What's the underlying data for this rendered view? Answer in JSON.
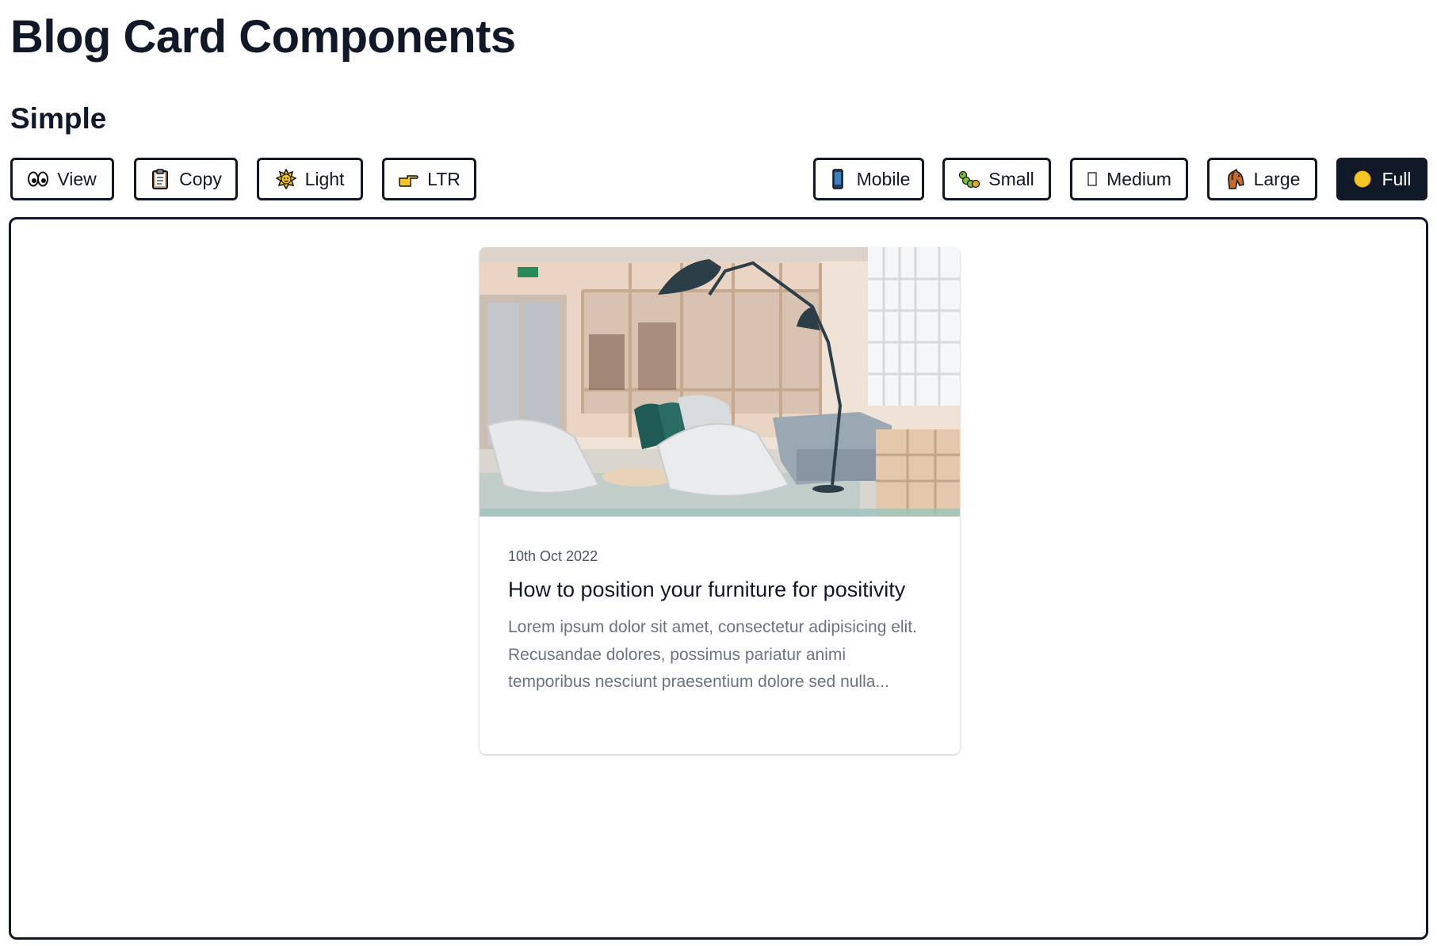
{
  "page": {
    "title": "Blog Card Components"
  },
  "section": {
    "title": "Simple"
  },
  "toolbar": {
    "left": [
      {
        "label": "View",
        "icon": "eyes-icon"
      },
      {
        "label": "Copy",
        "icon": "clipboard-icon"
      },
      {
        "label": "Light",
        "icon": "sun-icon"
      },
      {
        "label": "LTR",
        "icon": "pointing-hand-icon"
      }
    ],
    "right": [
      {
        "label": "Mobile",
        "icon": "mobile-phone-icon"
      },
      {
        "label": "Small",
        "icon": "caterpillar-icon"
      },
      {
        "label": "Medium",
        "icon": "tablet-icon"
      },
      {
        "label": "Large",
        "icon": "horse-icon"
      },
      {
        "label": "Full",
        "icon": "full-circle-icon",
        "active": true
      }
    ]
  },
  "card": {
    "image_alt": "Office lounge with chairs and lamp",
    "date": "10th Oct 2022",
    "title": "How to position your furniture for positivity",
    "excerpt": "Lorem ipsum dolor sit amet, consectetur adipisicing elit. Recusandae dolores, possimus pariatur animi temporibus nesciunt praesentium dolore sed nulla..."
  },
  "colors": {
    "dark": "#111827",
    "muted": "#6b7280",
    "border": "#111827"
  }
}
